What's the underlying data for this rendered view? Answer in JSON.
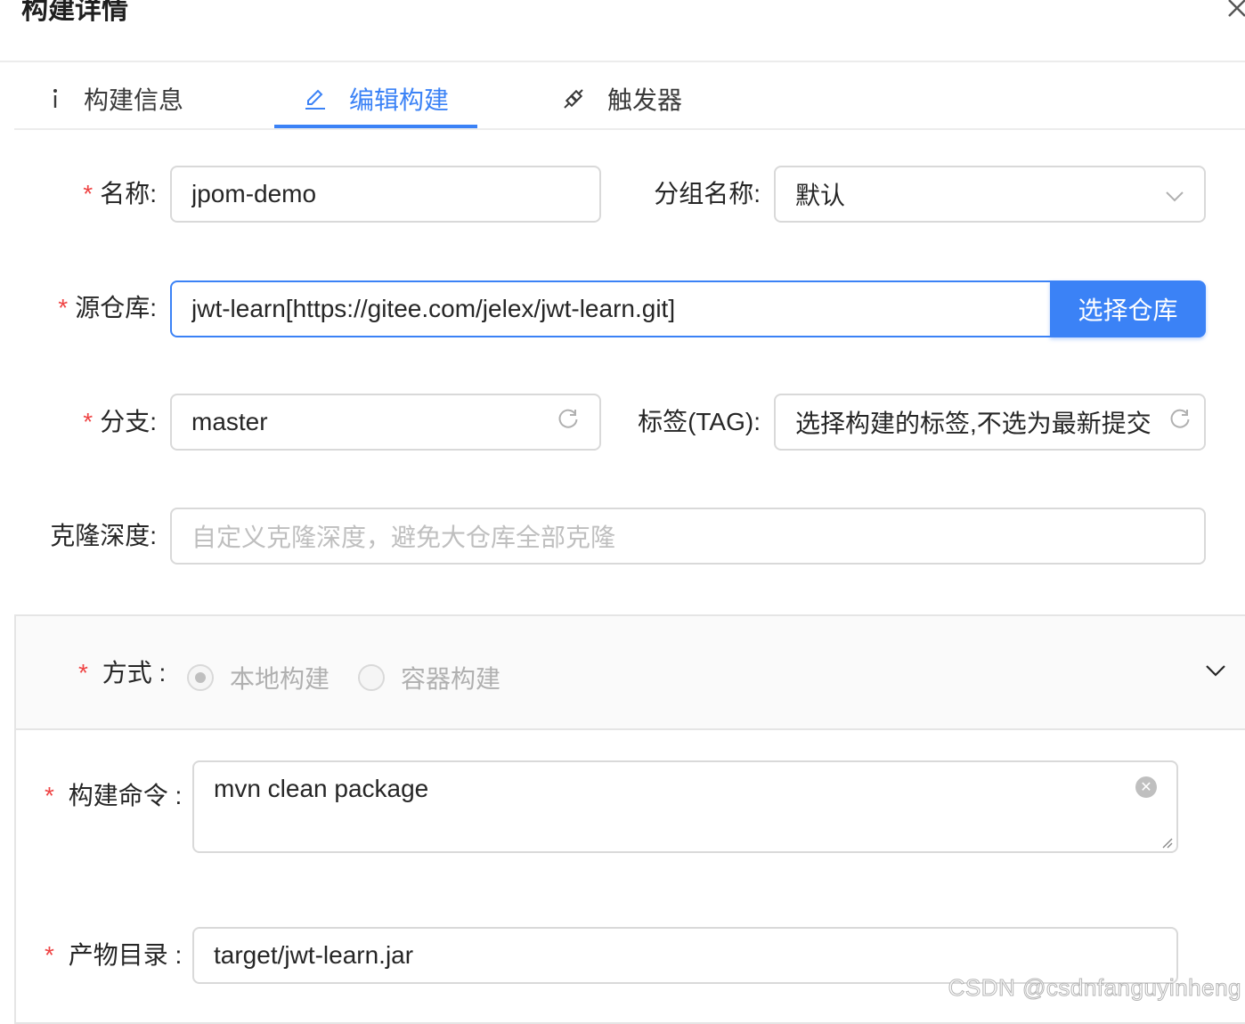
{
  "dialog": {
    "title": "构建详情"
  },
  "tabs": [
    {
      "label": "构建信息",
      "icon": "info-icon"
    },
    {
      "label": "编辑构建",
      "icon": "edit-icon",
      "active": true
    },
    {
      "label": "触发器",
      "icon": "api-icon"
    }
  ],
  "form": {
    "name": {
      "label": "名称",
      "value": "jpom-demo"
    },
    "group": {
      "label": "分组名称",
      "value": "默认"
    },
    "repo": {
      "label": "源仓库",
      "value": "jwt-learn[https://gitee.com/jelex/jwt-learn.git]",
      "button": "选择仓库"
    },
    "branch": {
      "label": "分支",
      "value": "master"
    },
    "tag": {
      "label": "标签(TAG)",
      "placeholder": "选择构建的标签,不选为最新提交"
    },
    "clone_depth": {
      "label": "克隆深度",
      "placeholder": "自定义克隆深度，避免大仓库全部克隆"
    },
    "mode": {
      "label": "方式",
      "options": [
        "本地构建",
        "容器构建"
      ],
      "selected": "本地构建"
    },
    "command": {
      "label": "构建命令",
      "value": "mvn clean package"
    },
    "artifact": {
      "label": "产物目录",
      "value": "target/jwt-learn.jar"
    }
  },
  "colors": {
    "accent": "#3b82f6",
    "required": "#ef4444"
  },
  "watermark": "CSDN @csdnfanguyinheng"
}
